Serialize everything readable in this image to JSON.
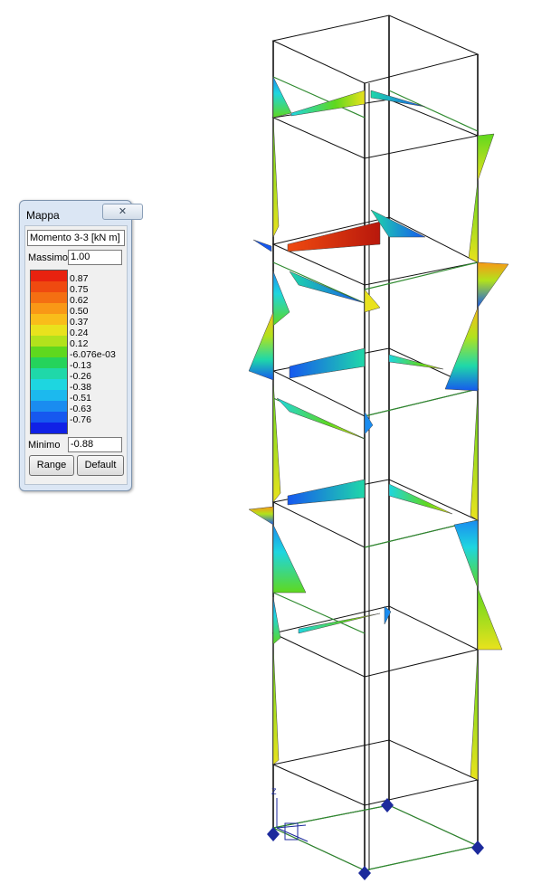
{
  "window": {
    "title": "Mappa",
    "close_glyph": "✕",
    "quantity": "Momento 3-3 [kN  m]",
    "max_label": "Massimo",
    "max_value": "1.00",
    "min_label": "Minimo",
    "min_value": "-0.88",
    "range_button": "Range",
    "default_button": "Default",
    "scale": [
      {
        "label": "0.87",
        "color": "#e8220f"
      },
      {
        "label": "0.75",
        "color": "#ef4a10"
      },
      {
        "label": "0.62",
        "color": "#f46f12"
      },
      {
        "label": "0.50",
        "color": "#f99816"
      },
      {
        "label": "0.37",
        "color": "#f9bd1a"
      },
      {
        "label": "0.24",
        "color": "#e9e21d"
      },
      {
        "label": "0.12",
        "color": "#b2e21c"
      },
      {
        "label": "-6.076e-03",
        "color": "#5fd81e"
      },
      {
        "label": "-0.13",
        "color": "#25d35b"
      },
      {
        "label": "-0.26",
        "color": "#1fd8a9"
      },
      {
        "label": "-0.38",
        "color": "#1ed6e0"
      },
      {
        "label": "-0.51",
        "color": "#1cb9ee"
      },
      {
        "label": "-0.63",
        "color": "#1a8cf0"
      },
      {
        "label": "-0.76",
        "color": "#1658ef"
      }
    ],
    "scale_bottom_color": "#1021e6"
  },
  "viewport": {
    "axis_label": "Z",
    "line_color": "#111111",
    "beam_color": "#2f8a2f",
    "support_color": "#1c2a9c"
  }
}
